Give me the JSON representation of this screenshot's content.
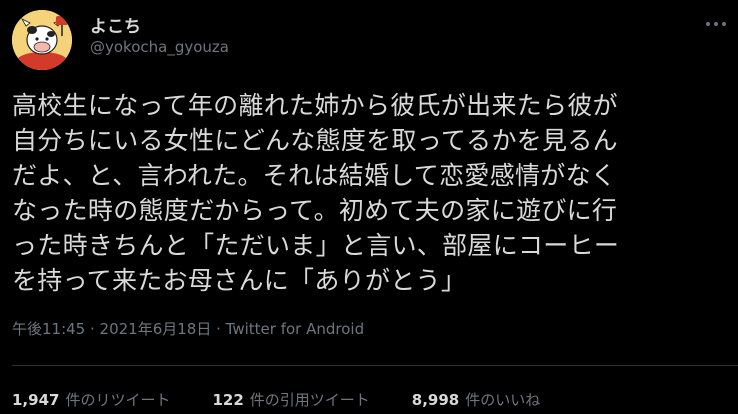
{
  "user": {
    "display_name": "よこち",
    "handle": "@yokocha_gyouza"
  },
  "tweet": {
    "text": "高校生になって年の離れた姉から彼氏が出来たら彼が\n自分ちにいる女性にどんな態度を取ってるかを見るん\nだよ、と、言われた。それは結婚して恋愛感情がなく\nなった時の態度だからって。初めて夫の家に遊びに行\nった時きちんと「ただいま」と言い、部屋にコーヒー\nを持って来たお母さんに「ありがとう」",
    "time": "午後11:45",
    "separator1": " · ",
    "date": "2021年6月18日",
    "separator2": " · ",
    "source": "Twitter for Android"
  },
  "stats": {
    "retweets_count": "1,947",
    "retweets_label": "件のリツイート",
    "quotes_count": "122",
    "quotes_label": "件の引用ツイート",
    "likes_count": "8,998",
    "likes_label": "件のいいね"
  },
  "colors": {
    "background": "#000000",
    "text": "#d9d9d9",
    "secondary": "#6e767d",
    "divider": "#2f3336",
    "avatar_bg": "#f4d37a"
  },
  "icons": {
    "avatar": "cow-chef-mascot-avatar",
    "more": "more-horizontal-icon"
  }
}
